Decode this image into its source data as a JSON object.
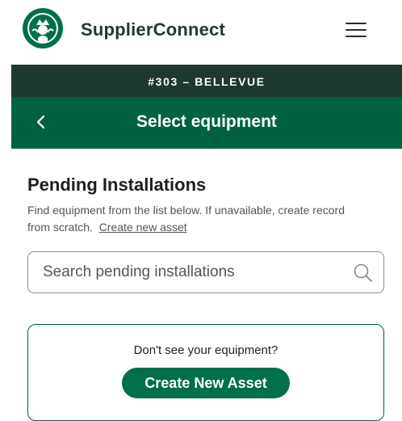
{
  "header": {
    "app_name": "SupplierConnect",
    "logo_icon": "starbucks-siren-logo",
    "menu_icon": "hamburger-menu-icon"
  },
  "store_banner": {
    "text": "#303 – BELLEVUE"
  },
  "nav": {
    "title": "Select equipment",
    "back_icon": "chevron-left-icon"
  },
  "pending": {
    "title": "Pending Installations",
    "description": "Find equipment from the list below. If unavailable, create record from scratch.",
    "create_link": "Create new asset"
  },
  "search": {
    "placeholder": "Search pending installations",
    "value": "",
    "icon": "search-icon"
  },
  "card": {
    "text": "Don't see your equipment?",
    "button_label": "Create New Asset"
  },
  "colors": {
    "dark_green": "#1e3932",
    "brand_green": "#006241",
    "button_green": "#00704a"
  }
}
